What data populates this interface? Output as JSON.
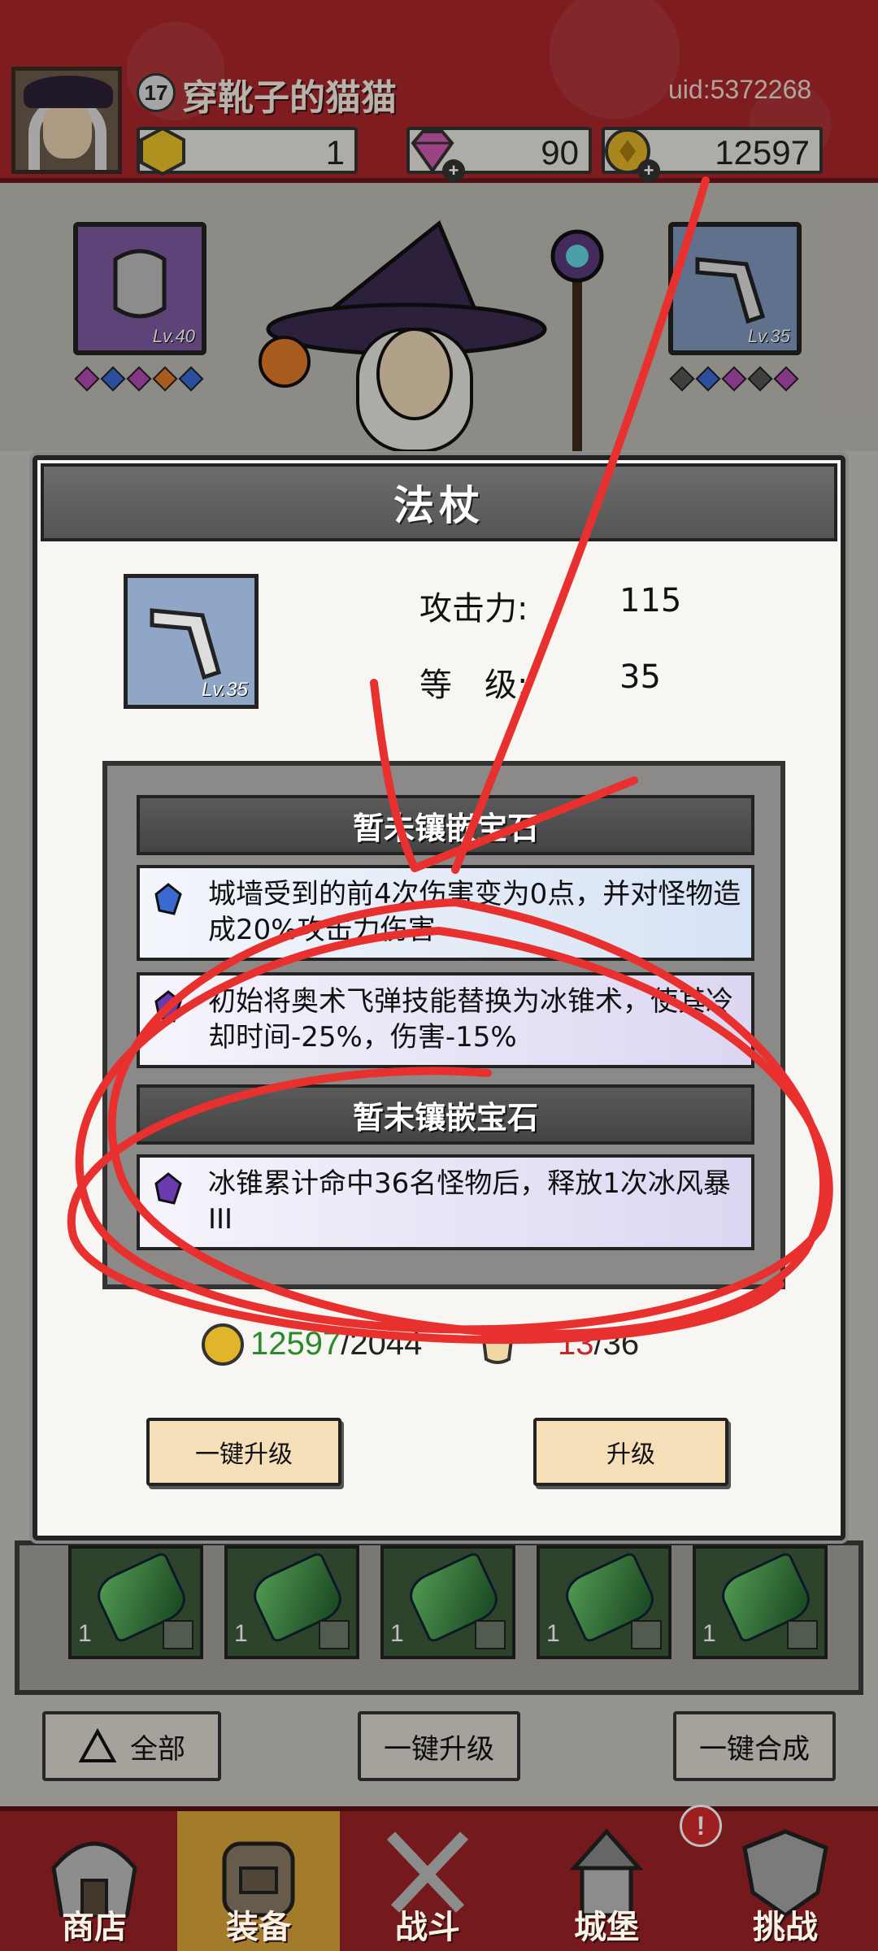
{
  "header": {
    "player_level": "17",
    "player_name": "穿靴子的猫猫",
    "uid": "uid:5372268",
    "currencies": [
      {
        "icon": "hexagon-gold-icon",
        "value": "1"
      },
      {
        "icon": "pink-diamond-icon",
        "value": "90",
        "plus": "+"
      },
      {
        "icon": "gold-coin-icon",
        "value": "12597",
        "plus": "+"
      }
    ]
  },
  "equipment": {
    "left_slot_level": "Lv.40",
    "right_slot_level": "Lv.35"
  },
  "modal": {
    "title": "法杖",
    "item_level": "Lv.35",
    "attack_label": "攻击力:",
    "attack_value": "115",
    "grade_label": "等　级:",
    "grade_value": "35",
    "slot_header_1": "暂未镶嵌宝石",
    "slot_header_2": "暂未镶嵌宝石",
    "effects": [
      {
        "gem": "blue-gem-icon",
        "text": "城墙受到的前4次伤害变为0点，并对怪物造成20%攻击力伤害"
      },
      {
        "gem": "purple-gem-icon",
        "text": "初始将奥术飞弹技能替换为冰锥术，使其冷却时间-25%，伤害-15%"
      },
      {
        "gem": "purple-gem-icon",
        "text": "冰锥累计命中36名怪物后，释放1次冰风暴III"
      }
    ],
    "cost_coin_have": "12597",
    "cost_coin_need": "/2044",
    "cost_scroll_have": "13",
    "cost_scroll_need": "/36",
    "btn_one_click": "一键升级",
    "btn_upgrade": "升级"
  },
  "inventory": {
    "counts": [
      "1",
      "1",
      "1",
      "1",
      "1"
    ]
  },
  "filters": {
    "all": "全部",
    "upgrade_all": "一键升级",
    "merge_all": "一键合成"
  },
  "nav": {
    "shop": "商店",
    "equipment": "装备",
    "battle": "战斗",
    "castle": "城堡",
    "challenge": "挑战",
    "notify": "!"
  },
  "colors": {
    "header_red": "#a8262a",
    "annotation_red": "#e8312f",
    "coin_have_green": "#2a8a2a",
    "scroll_have_red": "#c0262a"
  }
}
